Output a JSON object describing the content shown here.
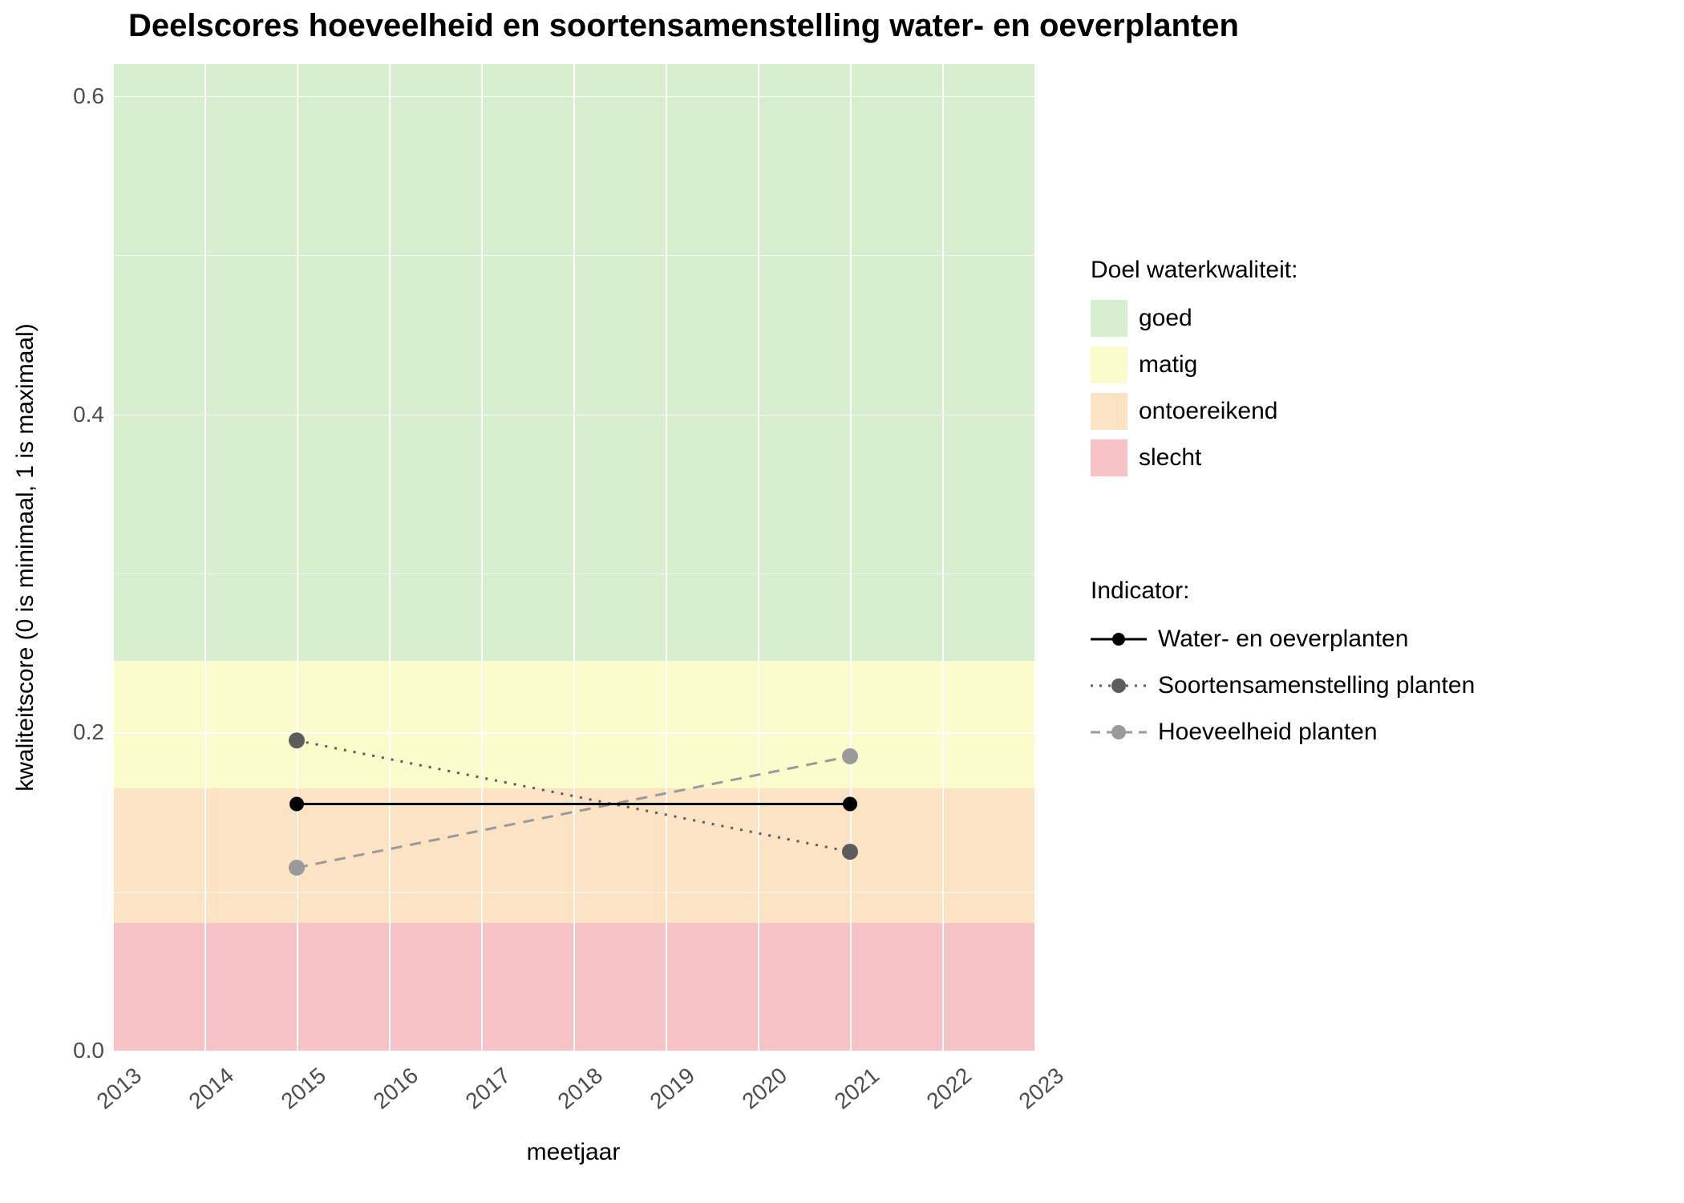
{
  "title": "Deelscores hoeveelheid en soortensamenstelling water- en oeverplanten",
  "xlabel": "meetjaar",
  "ylabel": "kwaliteitscore (0 is minimaal, 1 is maximaal)",
  "legend1": {
    "title": "Doel waterkwaliteit:",
    "items": [
      {
        "label": "goed",
        "color": "#d7efce"
      },
      {
        "label": "matig",
        "color": "#fbfccb"
      },
      {
        "label": "ontoereikend",
        "color": "#fce3c4"
      },
      {
        "label": "slecht",
        "color": "#f6c2c6"
      }
    ]
  },
  "legend2": {
    "title": "Indicator:",
    "items": [
      {
        "label": "Water- en oeverplanten"
      },
      {
        "label": "Soortensamenstelling planten"
      },
      {
        "label": "Hoeveelheid planten"
      }
    ]
  },
  "x_ticks": [
    "2013",
    "2014",
    "2015",
    "2016",
    "2017",
    "2018",
    "2019",
    "2020",
    "2021",
    "2022",
    "2023"
  ],
  "y_ticks": [
    "0.0",
    "0.2",
    "0.4",
    "0.6"
  ],
  "chart_data": {
    "type": "line",
    "title": "Deelscores hoeveelheid en soortensamenstelling water- en oeverplanten",
    "xlabel": "meetjaar",
    "ylabel": "kwaliteitscore (0 is minimaal, 1 is maximaal)",
    "xlim": [
      2013,
      2023
    ],
    "ylim": [
      0.0,
      0.62
    ],
    "x": [
      2015,
      2021
    ],
    "series": [
      {
        "name": "Water- en oeverplanten",
        "values": [
          0.155,
          0.155
        ],
        "color": "#000000",
        "linestyle": "solid"
      },
      {
        "name": "Soortensamenstelling planten",
        "values": [
          0.195,
          0.125
        ],
        "color": "#5c5c5c",
        "linestyle": "dotted"
      },
      {
        "name": "Hoeveelheid planten",
        "values": [
          0.115,
          0.185
        ],
        "color": "#9a9a9a",
        "linestyle": "dashed"
      }
    ],
    "bands": [
      {
        "name": "slecht",
        "ymin": 0.0,
        "ymax": 0.08,
        "color": "#f6c2c6"
      },
      {
        "name": "ontoereikend",
        "ymin": 0.08,
        "ymax": 0.165,
        "color": "#fce3c4"
      },
      {
        "name": "matig",
        "ymin": 0.165,
        "ymax": 0.245,
        "color": "#fbfccb"
      },
      {
        "name": "goed",
        "ymin": 0.245,
        "ymax": 0.62,
        "color": "#d7efce"
      }
    ]
  }
}
